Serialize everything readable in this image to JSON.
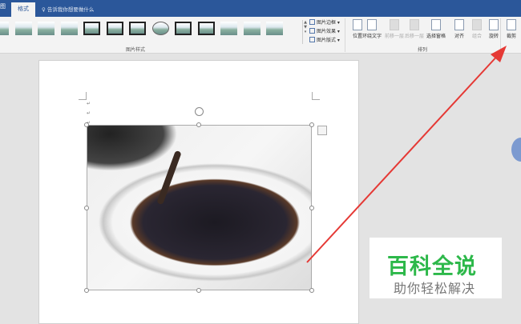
{
  "titlebar": {
    "tab_partial": "图",
    "tab_active": "格式",
    "tell_me": "告诉我你想要做什么"
  },
  "ribbon": {
    "picture_styles": {
      "label": "图片样式",
      "commands": [
        "图片边框",
        "图片效果",
        "图片版式"
      ]
    },
    "arrange": {
      "label": "排列",
      "buttons": [
        {
          "label": "位置",
          "enabled": true
        },
        {
          "label": "环绕文字",
          "enabled": true
        },
        {
          "label": "前移一层",
          "enabled": false
        },
        {
          "label": "后移一层",
          "enabled": false
        },
        {
          "label": "选择窗格",
          "enabled": true
        },
        {
          "label": "对齐",
          "enabled": true
        },
        {
          "label": "组合",
          "enabled": false
        },
        {
          "label": "旋转",
          "enabled": true
        }
      ]
    },
    "crop": {
      "label": "裁剪"
    }
  },
  "watermark": {
    "title": "百科全说",
    "subtitle": "助你轻松解决"
  },
  "colors": {
    "title_bar": "#2b579a",
    "watermark_green": "#2db84a",
    "arrow": "#e53935"
  }
}
